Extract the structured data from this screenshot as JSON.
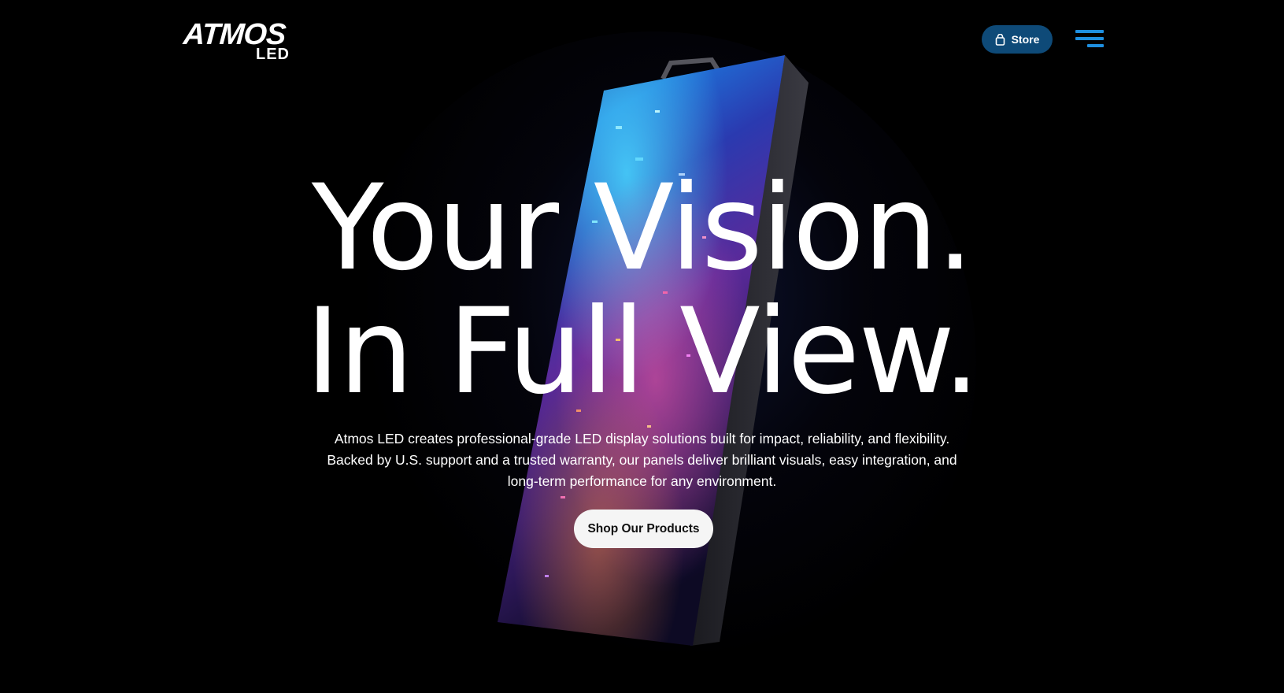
{
  "header": {
    "logo": {
      "primary_text": "ATMOS",
      "secondary_text": "LED"
    },
    "store_button": {
      "label": "Store",
      "icon": "shopping-bag-icon",
      "bg_color": "#0e4a78"
    },
    "menu_button": {
      "icon": "hamburger-menu-icon",
      "color": "#1e8fe0"
    }
  },
  "hero": {
    "headline_line1": "Your Vision.",
    "headline_line2": "In Full View.",
    "description_lines": [
      "Atmos LED creates professional-grade LED display solutions built for impact, reliability, and flexibility.",
      "Backed by U.S. support and a trusted warranty, our panels deliver brilliant visuals, easy integration, and",
      "long-term performance for any environment."
    ],
    "cta_label": "Shop Our Products",
    "background_color": "#000000"
  }
}
